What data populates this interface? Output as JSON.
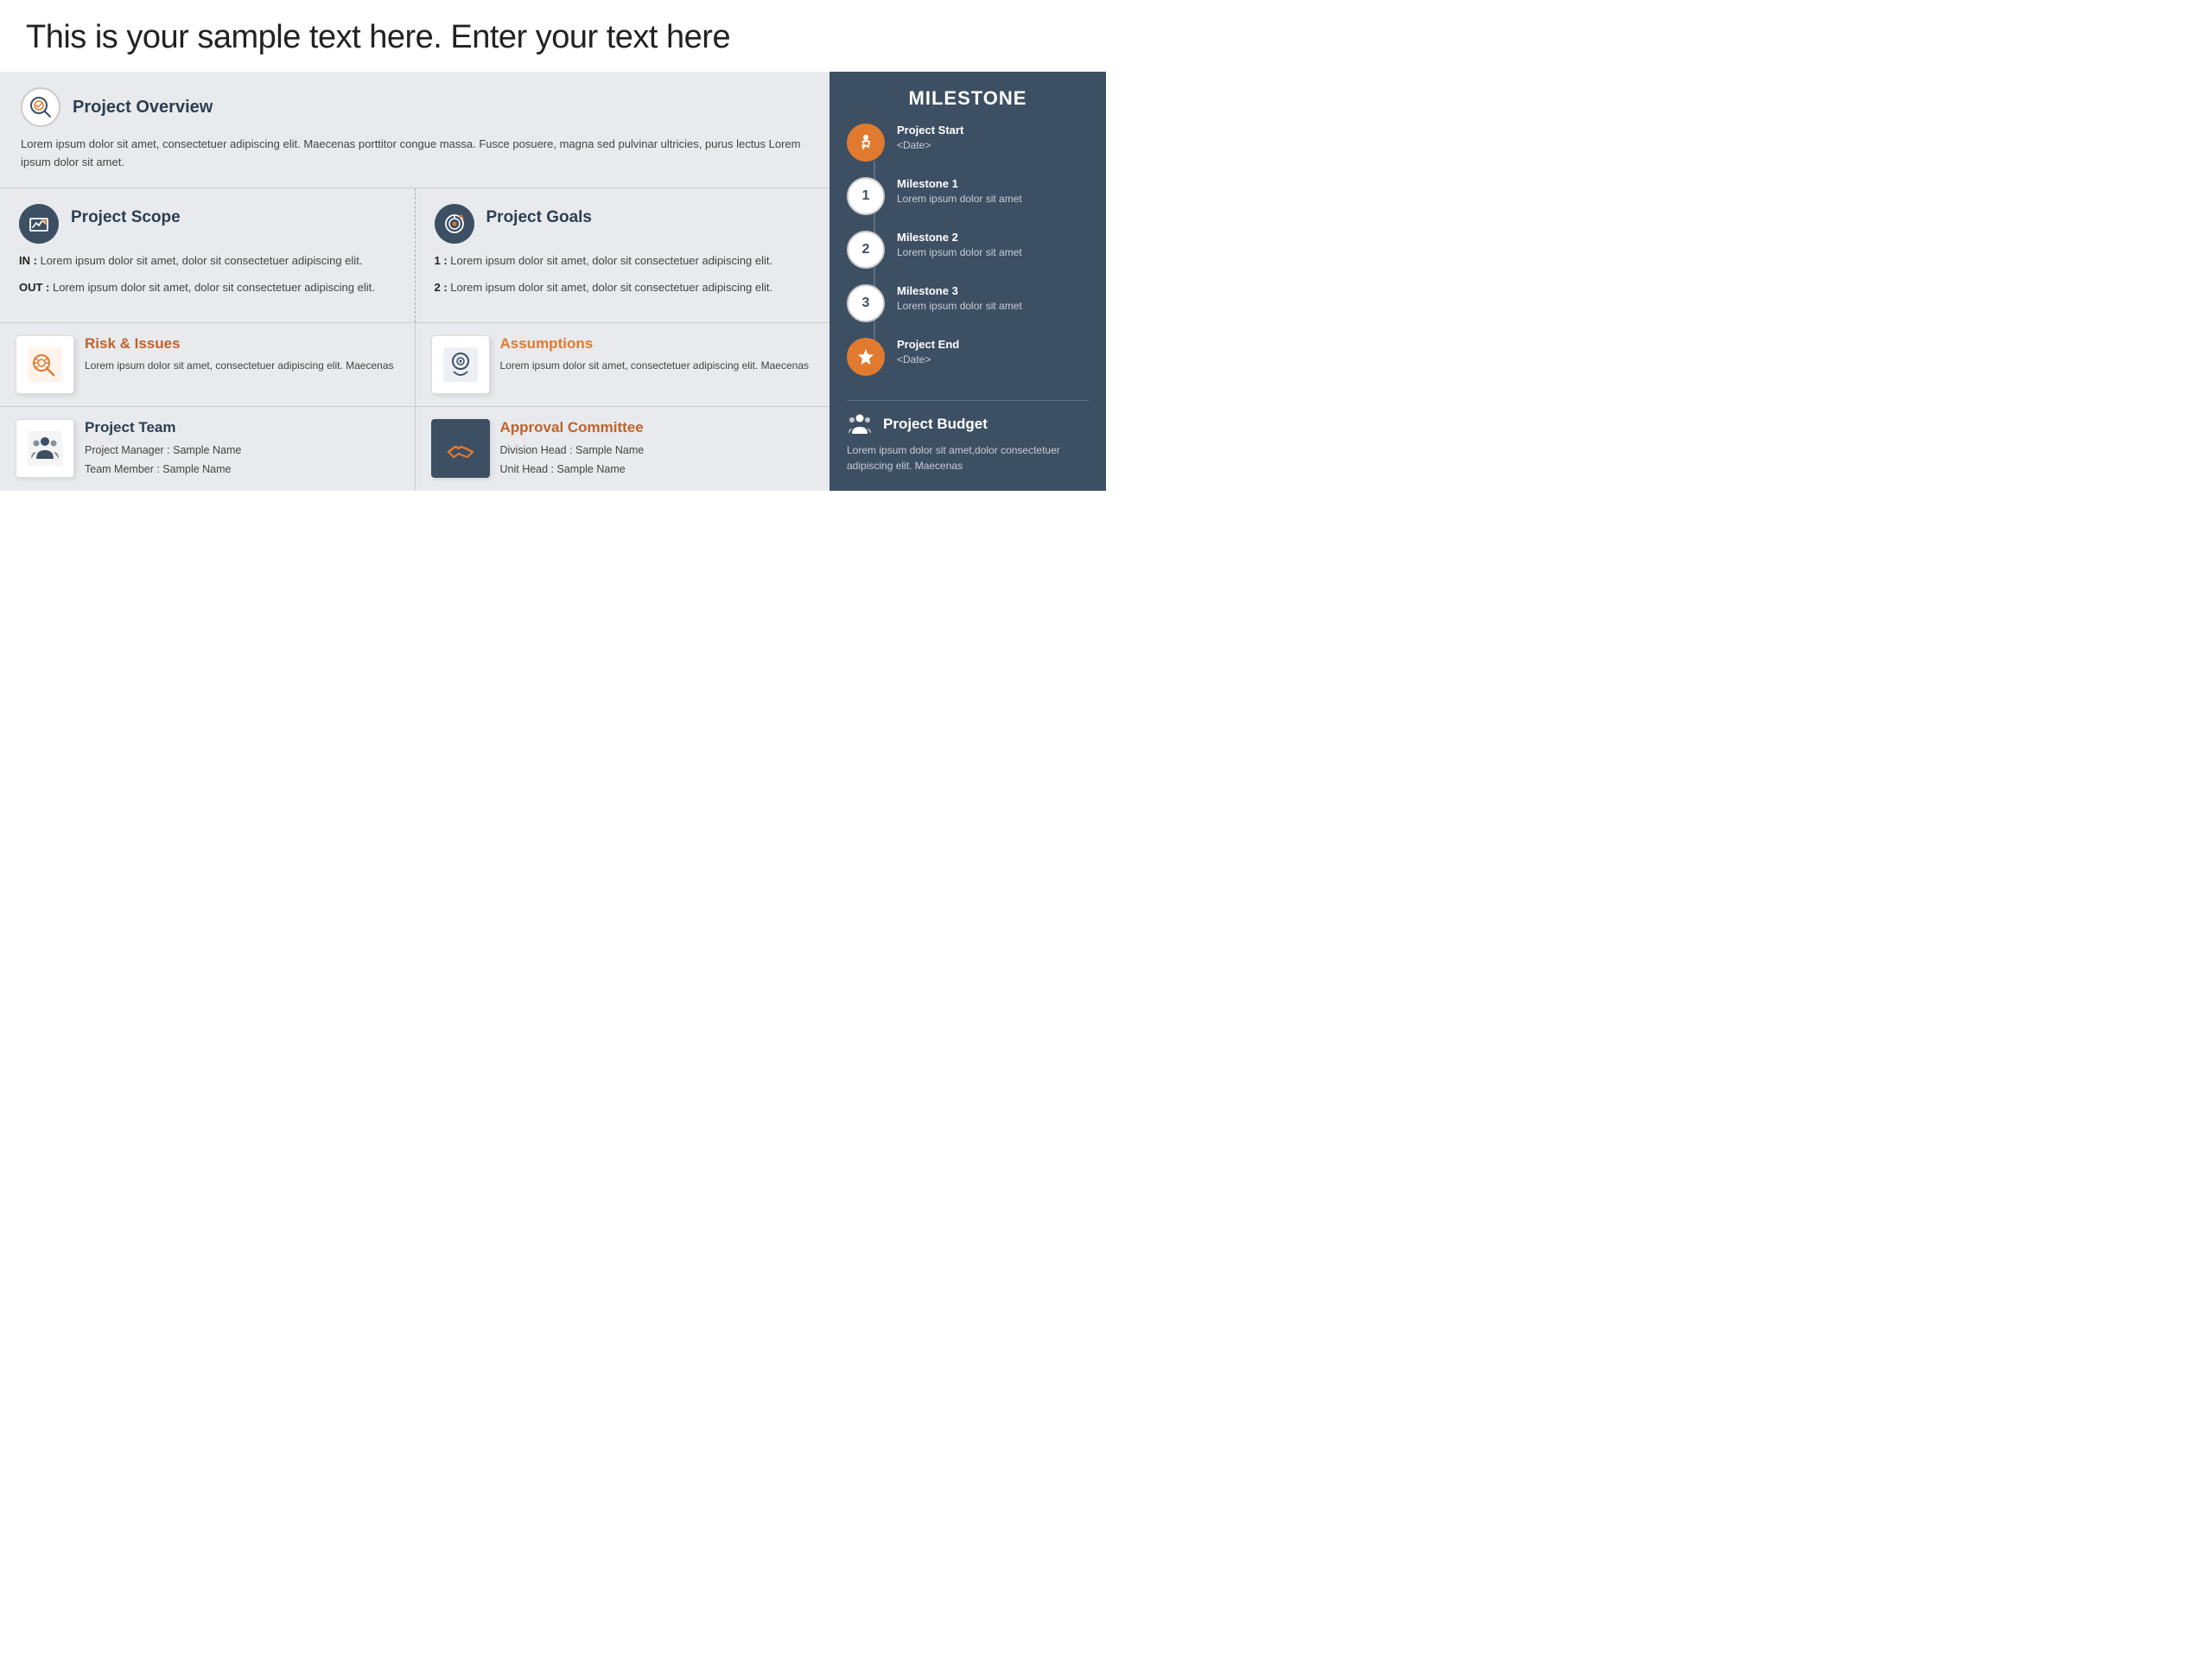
{
  "page": {
    "title": "This is your sample text here. Enter your text here"
  },
  "overview": {
    "title": "Project Overview",
    "text": "Lorem ipsum dolor sit amet, consectetuer adipiscing elit. Maecenas porttitor congue massa. Fusce posuere, magna sed pulvinar ultricies, purus lectus Lorem ipsum dolor sit amet."
  },
  "project_scope": {
    "title": "Project Scope",
    "in_label": "IN :",
    "in_text": "Lorem ipsum dolor sit amet, dolor sit consectetuer adipiscing elit.",
    "out_label": "OUT :",
    "out_text": "Lorem ipsum dolor sit amet, dolor sit consectetuer adipiscing elit."
  },
  "project_goals": {
    "title": "Project Goals",
    "item1_label": "1 :",
    "item1_text": "Lorem ipsum dolor sit amet, dolor sit consectetuer adipiscing elit.",
    "item2_label": "2 :",
    "item2_text": "Lorem ipsum dolor sit amet, dolor sit consectetuer adipiscing elit."
  },
  "risk": {
    "title": "Risk & Issues",
    "text": "Lorem ipsum dolor sit amet, consectetuer adipiscing elit. Maecenas"
  },
  "assumptions": {
    "title": "Assumptions",
    "text": "Lorem ipsum dolor sit amet, consectetuer adipiscing elit. Maecenas"
  },
  "project_team": {
    "title": "Project Team",
    "manager_label": "Project Manager : Sample Name",
    "member_label": "Team Member : Sample Name"
  },
  "approval_committee": {
    "title": "Approval Committee",
    "division_label": "Division Head : Sample Name",
    "unit_label": "Unit Head : Sample Name"
  },
  "milestone": {
    "header": "MILESTONE",
    "items": [
      {
        "label": "Project Start",
        "sublabel": "<Date>",
        "type": "run",
        "circle": "orange"
      },
      {
        "label": "Milestone 1",
        "sublabel": "Lorem ipsum dolor sit amet",
        "type": "number",
        "number": "1",
        "circle": "white"
      },
      {
        "label": "Milestone 2",
        "sublabel": "Lorem ipsum dolor sit amet",
        "type": "number",
        "number": "2",
        "circle": "white"
      },
      {
        "label": "Milestone 3",
        "sublabel": "Lorem ipsum dolor sit amet",
        "type": "number",
        "number": "3",
        "circle": "white"
      },
      {
        "label": "Project End",
        "sublabel": "<Date>",
        "type": "star",
        "circle": "orange"
      }
    ]
  },
  "budget": {
    "title": "Project Budget",
    "text": "Lorem ipsum dolor sit amet,dolor consectetuer adipiscing elit. Maecenas"
  }
}
